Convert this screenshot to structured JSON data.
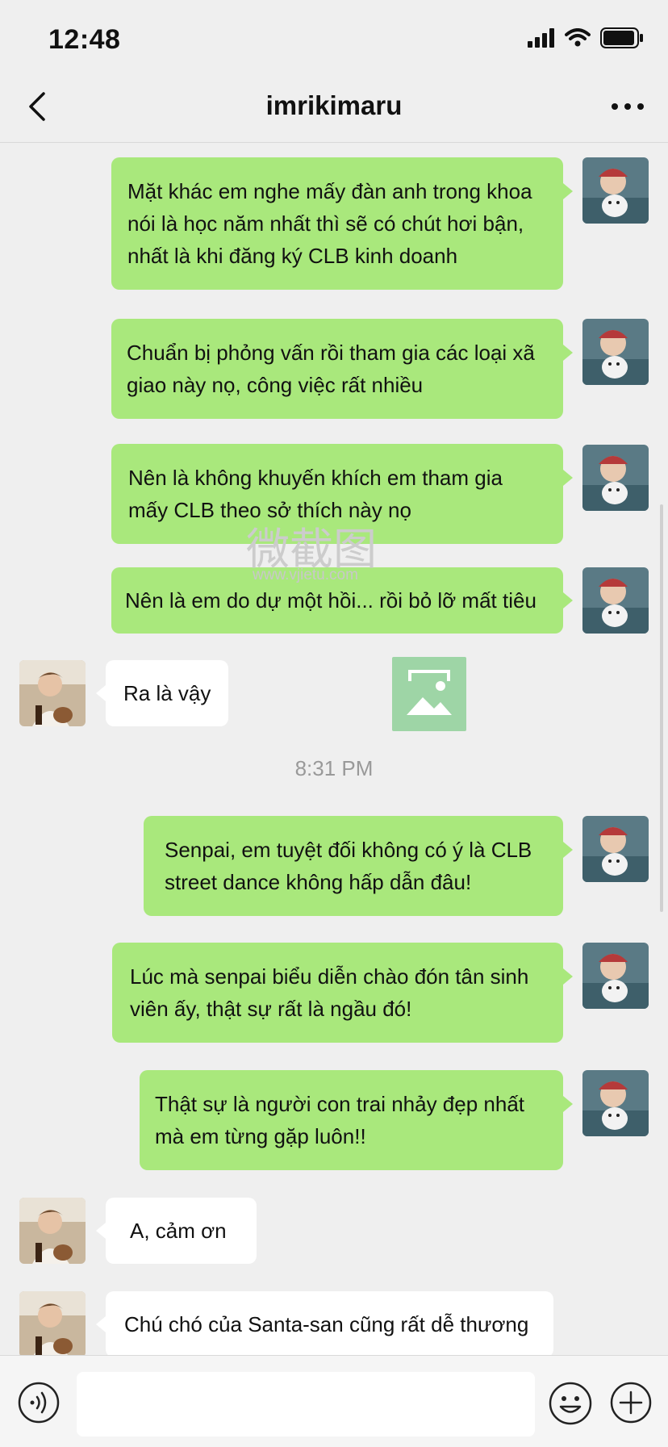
{
  "status_bar": {
    "time": "12:48"
  },
  "header": {
    "title": "imrikimaru"
  },
  "messages": [
    {
      "side": "out",
      "lines": [
        "Mặt khác em nghe mấy đàn anh trong khoa",
        "nói là học năm nhất thì sẽ có chút hơi bận,",
        "nhất là khi đăng ký CLB kinh doanh"
      ]
    },
    {
      "side": "out",
      "lines": [
        "Chuẩn bị phỏng vấn rồi tham gia các loại xã",
        "giao này nọ, công việc rất nhiều"
      ]
    },
    {
      "side": "out",
      "lines": [
        "Nên là không khuyến khích em tham gia",
        "mấy CLB theo sở thích này nọ"
      ]
    },
    {
      "side": "out",
      "lines": [
        "Nên là em do dự một hồi... rồi bỏ lỡ mất tiêu"
      ]
    },
    {
      "side": "in",
      "lines": [
        "Ra là vậy"
      ]
    },
    {
      "side": "out",
      "lines": [
        "Senpai, em tuyệt đối không có ý là CLB",
        "street dance không hấp dẫn đâu!"
      ]
    },
    {
      "side": "out",
      "lines": [
        "Lúc mà senpai biểu diễn chào đón tân sinh",
        "viên ấy, thật sự rất là ngầu đó!"
      ]
    },
    {
      "side": "out",
      "lines": [
        "Thật sự là người con trai nhảy đẹp nhất",
        "mà em từng gặp luôn!!"
      ]
    },
    {
      "side": "in",
      "lines": [
        "A, cảm ơn"
      ]
    },
    {
      "side": "in",
      "lines": [
        "Chú chó của Santa-san cũng rất dễ thương"
      ]
    }
  ],
  "timestamp": "8:31 PM",
  "watermark": {
    "text": "微截图",
    "url": "www.vjietu.com"
  },
  "input": {
    "placeholder": ""
  },
  "icons": [
    "back-icon",
    "more-icon",
    "voice-icon",
    "emoji-icon",
    "plus-icon"
  ],
  "colors": {
    "outgoing_bubble": "#a9e87c",
    "incoming_bubble": "#ffffff",
    "background": "#efefef"
  }
}
